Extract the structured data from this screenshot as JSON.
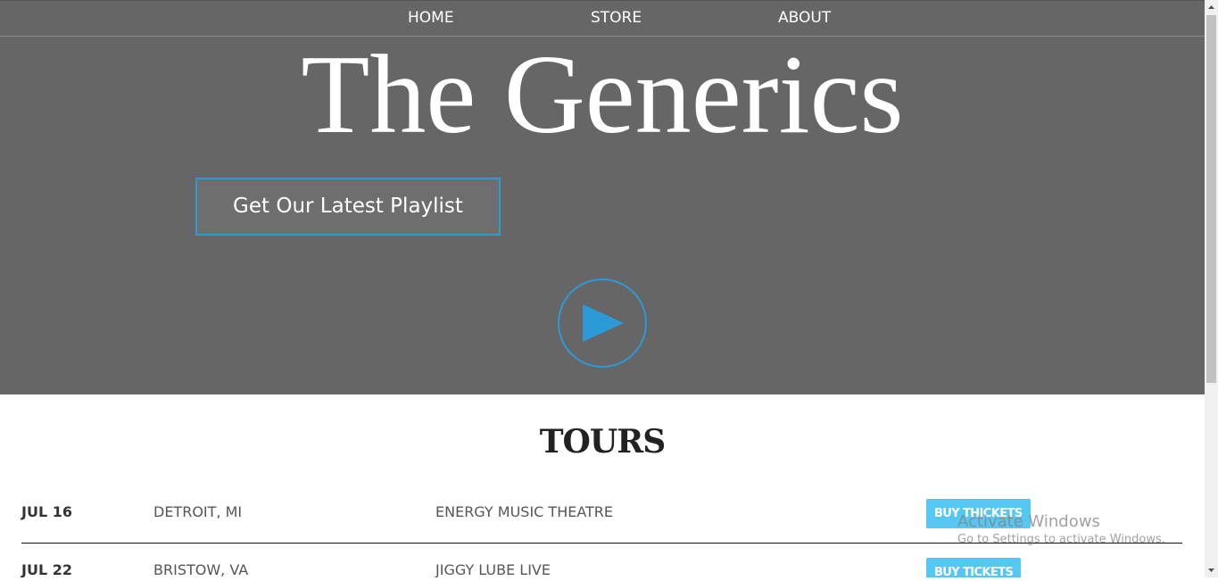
{
  "nav": {
    "home": "HOME",
    "store": "STORE",
    "about": "ABOUT"
  },
  "hero": {
    "title": "The Generics",
    "playlist_button": "Get Our Latest Playlist",
    "play_icon": "play-icon"
  },
  "tours": {
    "heading": "TOURS",
    "rows": [
      {
        "date": "JUL 16",
        "city": "DETROIT, MI",
        "venue": "ENERGY MUSIC THEATRE",
        "button": "BUY THICKETS"
      },
      {
        "date": "JUL 22",
        "city": "BRISTOW, VA",
        "venue": "JIGGY LUBE LIVE",
        "button": "BUY TICKETS"
      }
    ]
  },
  "watermark": {
    "title": "Activate Windows",
    "subtitle": "Go to Settings to activate Windows."
  },
  "colors": {
    "hero_bg": "#666666",
    "accent": "#2d9ad8",
    "buy_button": "#56c6f2"
  }
}
